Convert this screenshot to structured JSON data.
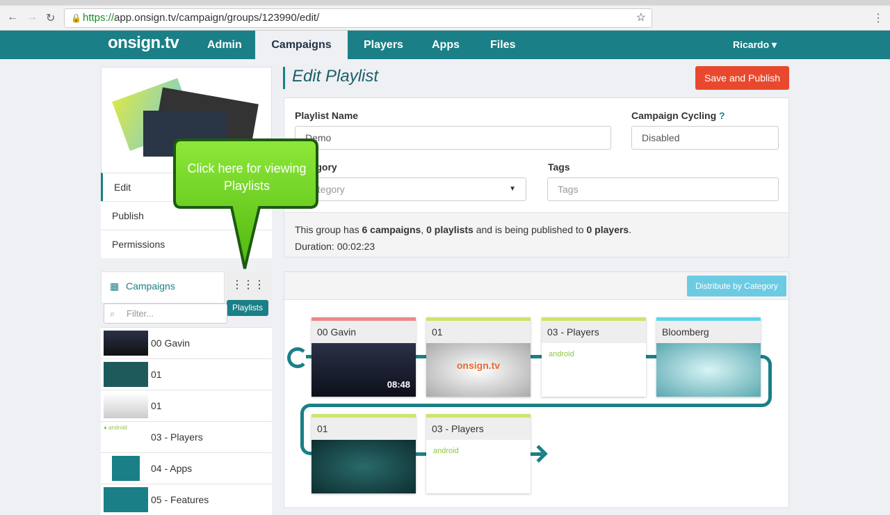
{
  "browser": {
    "url_scheme": "https://",
    "url_rest": "app.onsign.tv/campaign/groups/123990/edit/"
  },
  "nav": {
    "logo": "onsign.tv",
    "items": [
      "Admin",
      "Campaigns",
      "Players",
      "Apps",
      "Files"
    ],
    "active": "Campaigns",
    "user": "Ricardo ▾"
  },
  "sidebar": {
    "menu": [
      "Edit",
      "Publish",
      "Permissions"
    ],
    "tabs": {
      "campaigns": "Campaigns",
      "playlists_tooltip": "Playlists"
    },
    "filter_placeholder": "Filter...",
    "list": [
      "00 Gavin",
      "01",
      "01",
      "03 - Players",
      "04 - Apps",
      "05 - Features"
    ]
  },
  "callout": {
    "text": "Click here for viewing Playlists"
  },
  "main": {
    "title": "Edit Playlist",
    "save_button": "Save and Publish",
    "form": {
      "name_label": "Playlist Name",
      "name_value": "Demo",
      "cycling_label": "Campaign Cycling",
      "cycling_value": "Disabled",
      "category_label": "Category",
      "category_placeholder": "Category",
      "tags_label": "Tags",
      "tags_placeholder": "Tags"
    },
    "info": {
      "prefix": "This group has ",
      "campaigns": "6 campaigns",
      "sep": ", ",
      "playlists": "0 playlists",
      "mid": " and is being published to ",
      "players": "0 players",
      "end": ".",
      "duration": "Duration: 00:02:23"
    },
    "distribute_button": "Distribute by Category",
    "cards": [
      {
        "title": "00 Gavin",
        "color": "#f0868c"
      },
      {
        "title": "01",
        "color": "#cde56a"
      },
      {
        "title": "03 - Players",
        "color": "#cde56a",
        "android": "android"
      },
      {
        "title": "Bloomberg",
        "color": "#5bd6ea"
      },
      {
        "title": "01",
        "color": "#cde56a"
      },
      {
        "title": "03 - Players",
        "color": "#cde56a",
        "android": "android"
      }
    ]
  },
  "colors": {
    "nav": "#1a7f86",
    "save": "#e8492e",
    "distribute": "#6ccbe3",
    "callout": "#6fd11a"
  }
}
